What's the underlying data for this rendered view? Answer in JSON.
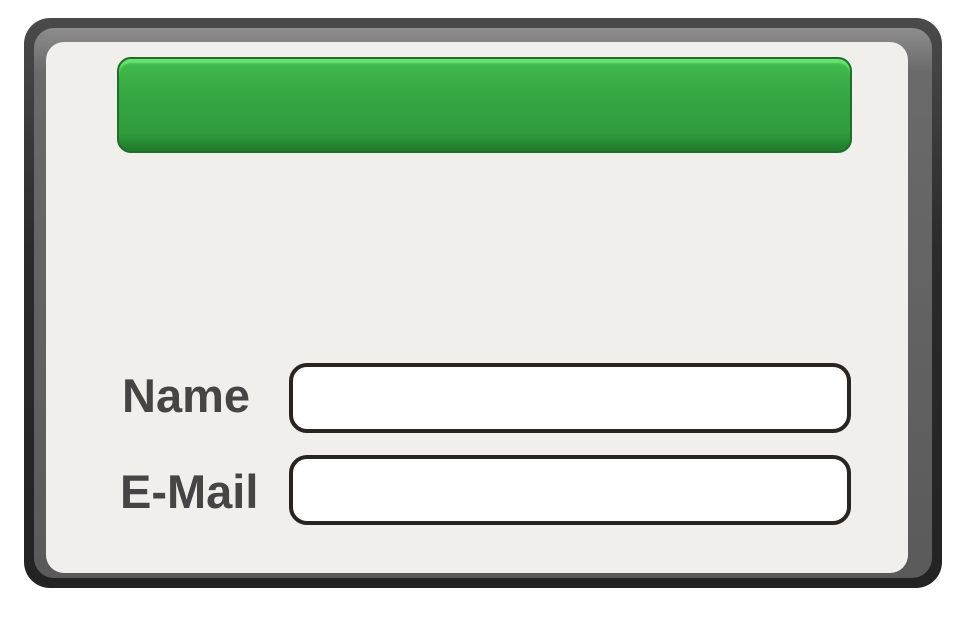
{
  "form": {
    "title": "",
    "fields": [
      {
        "label": "Name",
        "value": "",
        "placeholder": ""
      },
      {
        "label": "E-Mail",
        "value": "",
        "placeholder": ""
      }
    ]
  },
  "colors": {
    "frame": "#2b2b2b",
    "panel": "#f1efeb",
    "title_bar": "#35a443",
    "label_text": "#454545",
    "input_border": "#2a2421"
  }
}
